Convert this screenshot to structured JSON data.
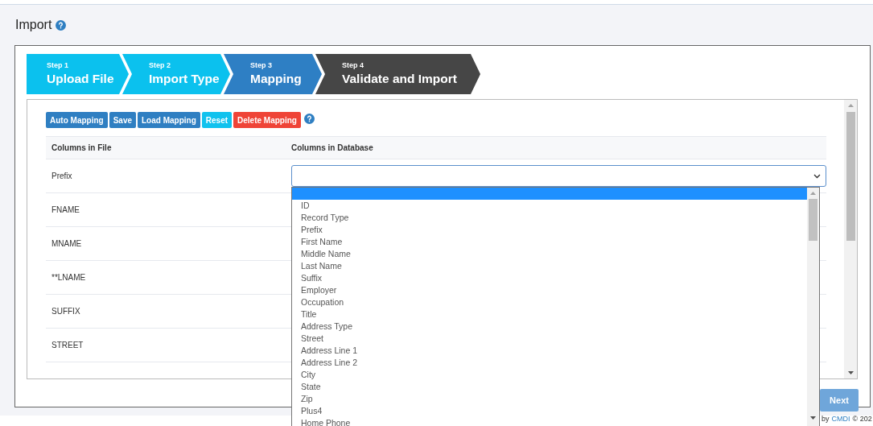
{
  "page": {
    "title": "Import"
  },
  "steps": [
    {
      "step": "Step 1",
      "label": "Upload File",
      "completed": true,
      "selected": false
    },
    {
      "step": "Step 2",
      "label": "Import Type",
      "completed": true,
      "selected": false
    },
    {
      "step": "Step 3",
      "label": "Mapping",
      "completed": false,
      "selected": true
    },
    {
      "step": "Step 4",
      "label": "Validate and Import",
      "completed": false,
      "selected": false
    }
  ],
  "toolbar": [
    {
      "label": "Auto Mapping",
      "kind": "primary"
    },
    {
      "label": "Save",
      "kind": "primary"
    },
    {
      "label": "Load Mapping",
      "kind": "primary"
    },
    {
      "label": "Reset",
      "kind": "info"
    },
    {
      "label": "Delete Mapping",
      "kind": "danger"
    }
  ],
  "table": {
    "columns": [
      "Columns in File",
      "Columns in Database"
    ],
    "rows": [
      {
        "file_column": "Prefix",
        "dropdown": {
          "blank_option_highlighted": true,
          "options": [
            "ID",
            "Record Type",
            "Prefix",
            "First Name",
            "Middle Name",
            "Last Name",
            "Suffix",
            "Employer",
            "Occupation",
            "Title",
            "Address Type",
            "Street",
            "Address Line 1",
            "Address Line 2",
            "City",
            "State",
            "Zip",
            "Plus4",
            "Home Phone"
          ]
        }
      },
      {
        "file_column": "FNAME"
      },
      {
        "file_column": "MNAME"
      },
      {
        "file_column": "**LNAME"
      },
      {
        "file_column": "SUFFIX"
      },
      {
        "file_column": "STREET"
      }
    ]
  },
  "next_button": {
    "label": "Next",
    "disabled": true
  },
  "footer": {
    "prefix": "by",
    "link": "CMDI",
    "suffix": "© 202"
  }
}
